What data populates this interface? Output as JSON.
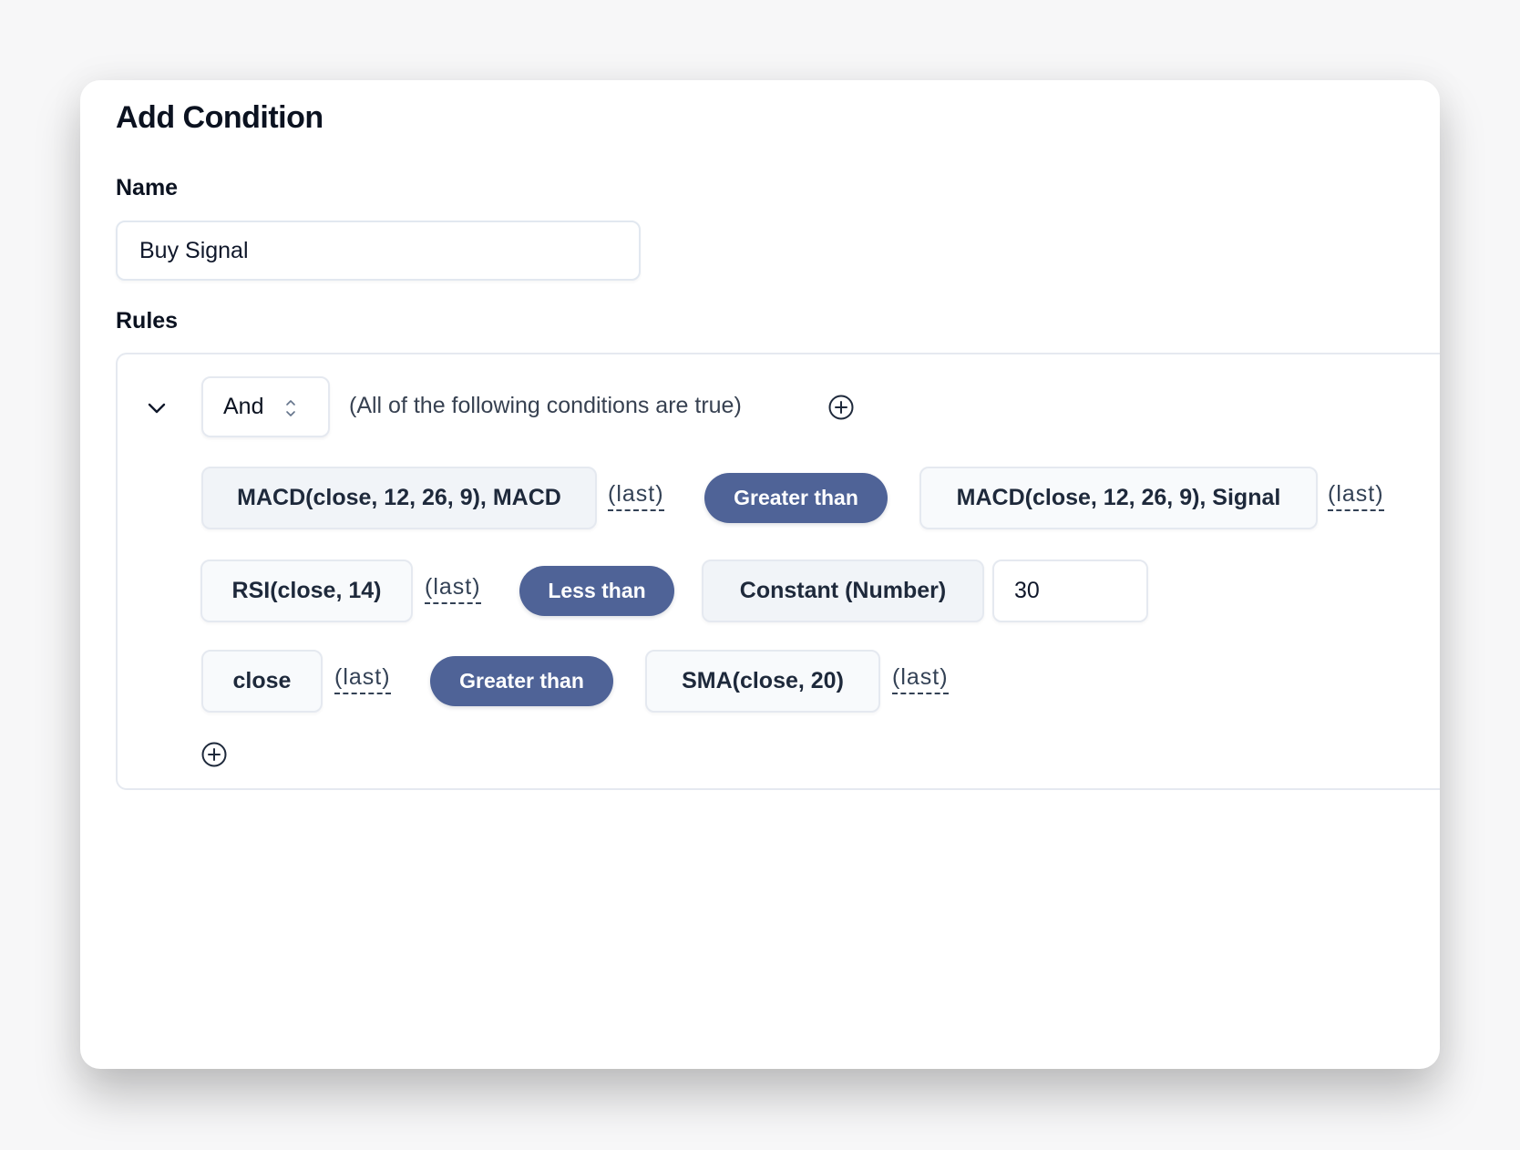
{
  "dialog": {
    "title": "Add Condition",
    "name_label": "Name",
    "name_value": "Buy Signal",
    "rules_label": "Rules"
  },
  "group": {
    "operator": "And",
    "description": "(All of the following conditions are true)",
    "icons": {
      "collapse": "chevron-down-icon",
      "operator_select": "chevron-up-down-icon",
      "add_condition": "plus-circle-icon",
      "add_rule": "plus-circle-icon"
    }
  },
  "rules": [
    {
      "left": "MACD(close, 12, 26, 9), MACD",
      "left_mode": "(last)",
      "comparator": "Greater than",
      "right": "MACD(close, 12, 26, 9), Signal",
      "right_mode": "(last)"
    },
    {
      "left": "RSI(close, 14)",
      "left_mode": "(last)",
      "comparator": "Less than",
      "right": "Constant (Number)",
      "right_value": "30"
    },
    {
      "left": "close",
      "left_mode": "(last)",
      "comparator": "Greater than",
      "right": "SMA(close, 20)",
      "right_mode": "(last)"
    }
  ],
  "colors": {
    "comparator_pill": "#4f6397",
    "chip_border": "#e5e9f0",
    "text_primary": "#0b1220"
  }
}
